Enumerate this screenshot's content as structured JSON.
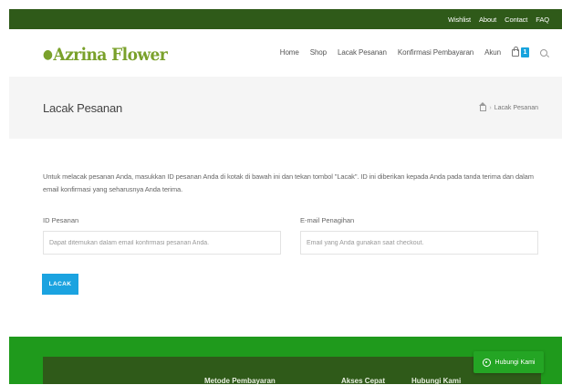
{
  "topbar": {
    "links": [
      "Wishlist",
      "About",
      "Contact",
      "FAQ"
    ]
  },
  "header": {
    "logo": "Azrina Flower",
    "nav": [
      "Home",
      "Shop",
      "Lacak Pesanan",
      "Konfirmasi Pembayaran",
      "Akun"
    ],
    "cart_count": "1"
  },
  "title_band": {
    "title": "Lacak Pesanan",
    "breadcrumb_current": "Lacak Pesanan"
  },
  "form": {
    "intro": "Untuk melacak pesanan Anda, masukkan ID pesanan Anda di kotak di bawah ini dan tekan tombol \"Lacak\". ID ini diberikan kepada Anda pada tanda terima dan dalam email konfirmasi yang seharusnya Anda terima.",
    "order_id_label": "ID Pesanan",
    "order_id_placeholder": "Dapat ditemukan dalam email konfirmasi pesanan Anda.",
    "email_label": "E-mail Penagihan",
    "email_placeholder": "Email yang Anda gunakan saat checkout.",
    "submit_label": "LACAK"
  },
  "footer": {
    "headings": [
      "Metode Pembayaran",
      "Akses Cepat",
      "Hubungi Kami"
    ]
  },
  "contact_button": {
    "label": "Hubungi Kami"
  },
  "colors": {
    "topbar": "#2f5a19",
    "logo": "#7aa12b",
    "accent": "#1ba3e0",
    "footer": "#1f9a1c",
    "contact_button": "#24a524"
  }
}
